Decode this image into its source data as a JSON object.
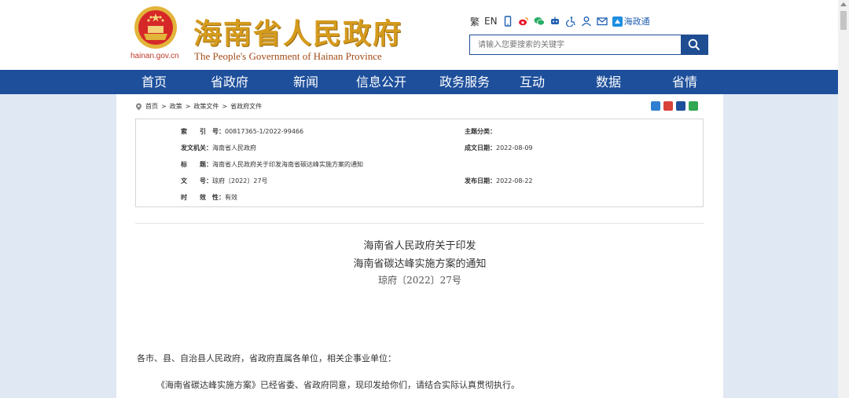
{
  "header": {
    "site_title": "海南省人民政府",
    "site_subtitle": "The People's Government  of Hainan Province",
    "domain": "hainan.gov.cn",
    "tools": {
      "traditional": "繁",
      "english": "EN",
      "hainan_app": "海政通"
    },
    "search_placeholder": "请输入您要搜索的关键字"
  },
  "nav": {
    "items": [
      "首页",
      "省政府",
      "新闻",
      "信息公开",
      "政务服务",
      "互动",
      "数据",
      "省情"
    ]
  },
  "breadcrumb": {
    "items": [
      "首页",
      "政策",
      "政策文件",
      "省政府文件"
    ],
    "sep": ">"
  },
  "meta": {
    "index_label": "索　　引　号：",
    "index_value": "00817365-1/2022-99466",
    "category_label": "主题分类：",
    "category_value": "",
    "issuer_label": "发文机关：",
    "issuer_value": "海南省人民政府",
    "created_label": "成文日期：",
    "created_value": "2022-08-09",
    "title_label": "标　　题：",
    "title_value": "海南省人民政府关于印发海南省碳达峰实施方案的通知",
    "docno_label": "文　　号：",
    "docno_value": "琼府〔2022〕27号",
    "published_label": "发布日期：",
    "published_value": "2022-08-22",
    "validity_label": "时　　效　性：",
    "validity_value": "有效"
  },
  "document": {
    "title_line1": "海南省人民政府关于印发",
    "title_line2": "海南省碳达峰实施方案的通知",
    "number": "琼府〔2022〕27号",
    "salutation": "各市、县、自治县人民政府，省政府直属各单位，相关企事业单位：",
    "paragraph1": "《海南省碳达峰实施方案》已经省委、省政府同意，现印发给你们，请结合实际认真贯彻执行。"
  },
  "colors": {
    "nav_bg": "#1d4f9b",
    "title_gold": "#d59b1d",
    "page_bg": "#dfe8f3"
  }
}
